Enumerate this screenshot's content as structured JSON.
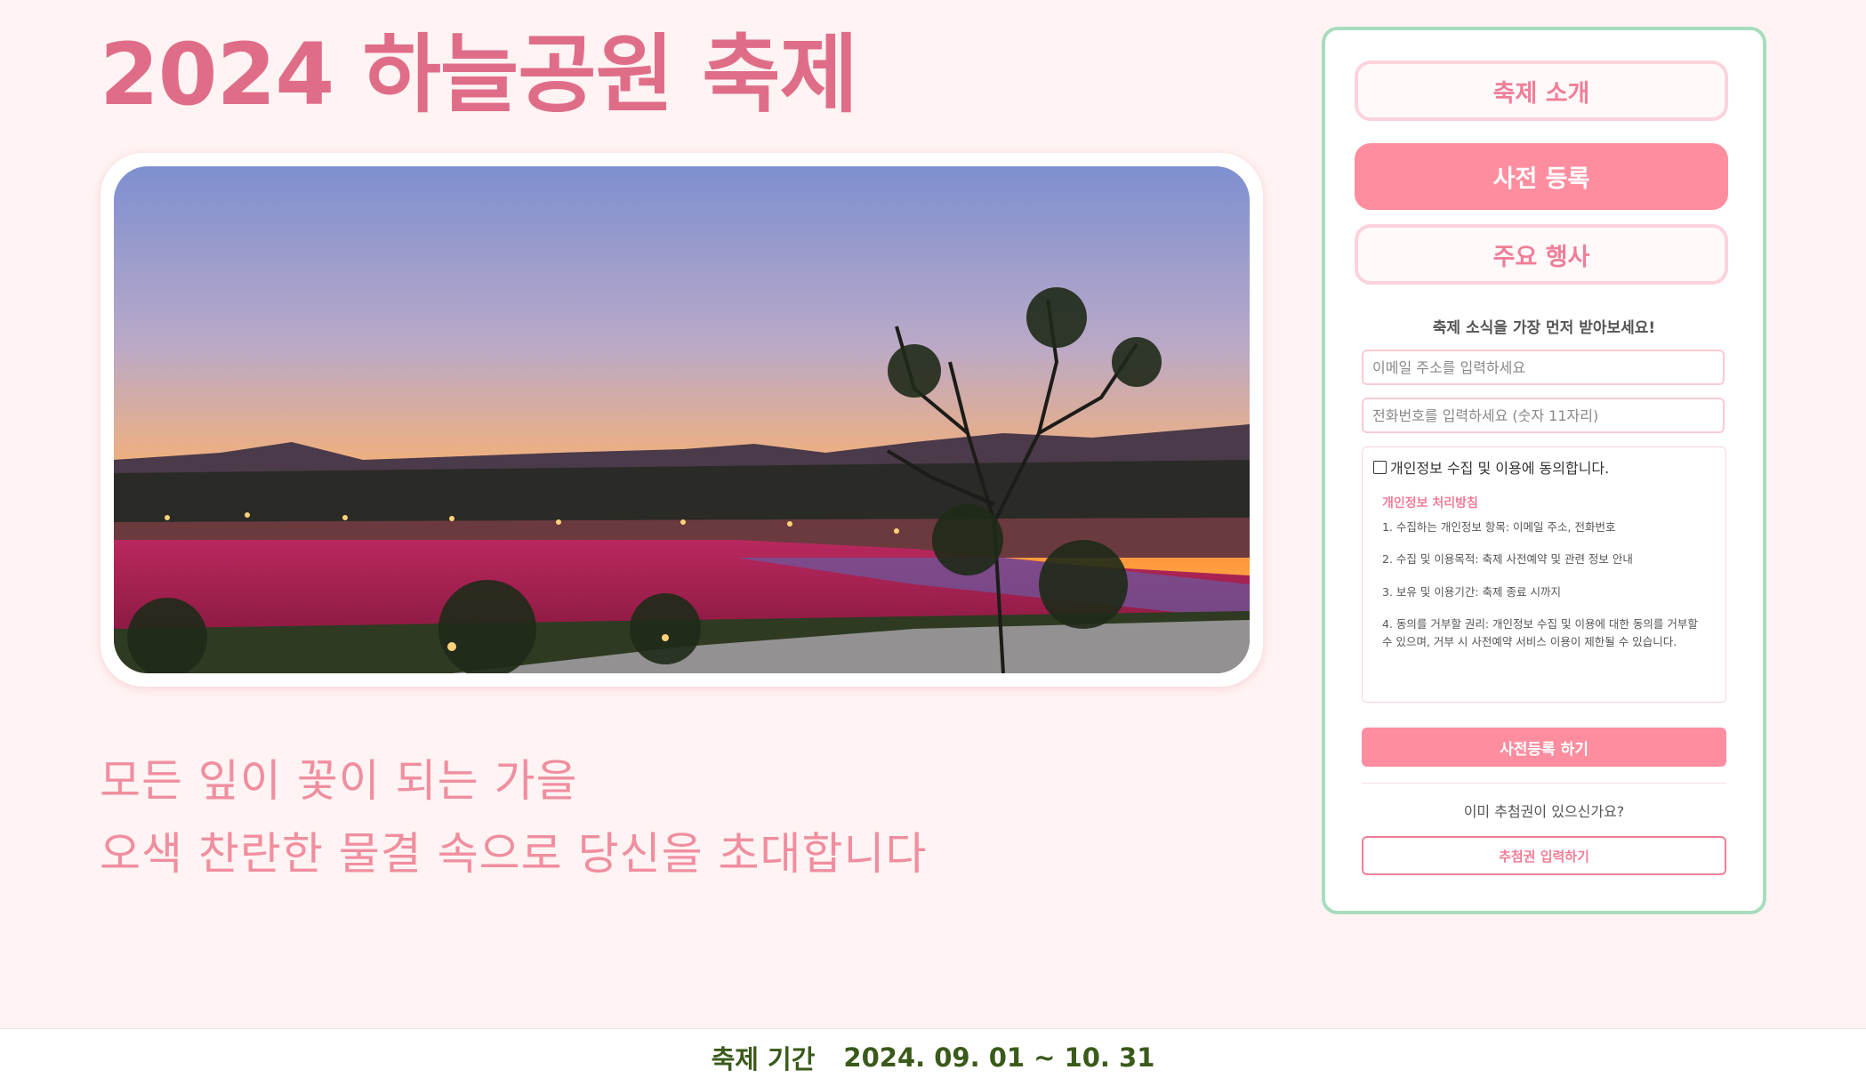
{
  "header": {
    "title": "2024 하늘공원 축제"
  },
  "hero": {
    "tagline_line1": "모든 잎이 꽃이 되는 가을",
    "tagline_line2": "오색 찬란한 물결 속으로 당신을 초대합니다"
  },
  "sidebar": {
    "nav": [
      {
        "label": "축제 소개",
        "active": false
      },
      {
        "label": "사전 등록",
        "active": true
      },
      {
        "label": "주요 행사",
        "active": false
      }
    ],
    "signup": {
      "heading": "축제 소식을 가장 먼저 받아보세요!",
      "email_placeholder": "이메일 주소를 입력하세요",
      "phone_placeholder": "전화번호를 입력하세요 (숫자 11자리)",
      "consent_label": "개인정보 수집 및 이용에 동의합니다.",
      "policy_title": "개인정보 처리방침",
      "policy_items": [
        "1. 수집하는 개인정보 항목: 이메일 주소, 전화번호",
        "2. 수집 및 이용목적: 축제 사전예약 및 관련 정보 안내",
        "3. 보유 및 이용기간: 축제 종료 시까지",
        "4. 동의를 거부할 권리: 개인정보 수집 및 이용에 대한 동의를 거부할 수 있으며, 거부 시 사전예약 서비스 이용이 제한될 수 있습니다."
      ],
      "submit_label": "사전등록 하기",
      "ticket_question": "이미 추첨권이 있으신가요?",
      "ticket_button": "추첨권 입력하기"
    }
  },
  "footer": {
    "period_label": "축제 기간",
    "period_value": "2024. 09. 01 ~ 10. 31"
  },
  "colors": {
    "accent_pink": "#fe8e9f",
    "title_pink": "#e06d88",
    "panel_border": "#a8dcbf",
    "footer_text": "#3a5a1a"
  }
}
